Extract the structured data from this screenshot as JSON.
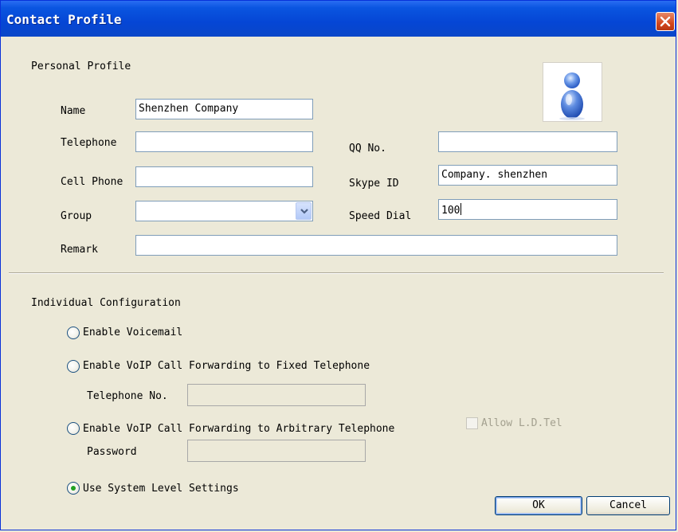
{
  "window": {
    "title": "Contact Profile"
  },
  "personal": {
    "section_title": "Personal Profile",
    "name_label": "Name",
    "name_value": "Shenzhen Company",
    "telephone_label": "Telephone",
    "telephone_value": "",
    "cell_phone_label": "Cell Phone",
    "cell_phone_value": "",
    "group_label": "Group",
    "group_value": "",
    "remark_label": "Remark",
    "remark_value": "",
    "qq_label": "QQ No.",
    "qq_value": "",
    "skype_label": "Skype ID",
    "skype_value": "Company. shenzhen",
    "speed_dial_label": "Speed Dial",
    "speed_dial_value": "100"
  },
  "config": {
    "section_title": "Individual Configuration",
    "options": [
      {
        "label": "Enable Voicemail",
        "selected": false
      },
      {
        "label": "Enable VoIP Call Forwarding to Fixed Telephone",
        "selected": false
      },
      {
        "label": "Enable VoIP Call Forwarding to Arbitrary Telephone",
        "selected": false
      },
      {
        "label": "Use System Level Settings",
        "selected": true
      }
    ],
    "telephone_no_label": "Telephone No.",
    "telephone_no_value": "",
    "password_label": "Password",
    "password_value": "",
    "allow_ld_label": "Allow L.D.Tel",
    "allow_ld_checked": false
  },
  "buttons": {
    "ok": "OK",
    "cancel": "Cancel"
  },
  "icons": {
    "close": "close-icon",
    "avatar": "user-avatar-icon",
    "dropdown": "chevron-down-icon"
  },
  "colors": {
    "titlebar": "#0546d5",
    "close": "#d3471d",
    "window_bg": "#ece9d8",
    "radio_dot": "#21a121"
  }
}
